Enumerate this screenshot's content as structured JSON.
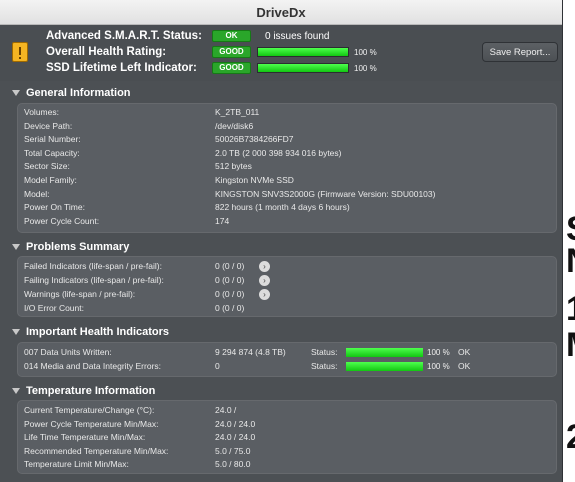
{
  "window": {
    "title": "DriveDx"
  },
  "header": {
    "smart_label": "Advanced S.M.A.R.T. Status:",
    "smart_badge": "OK",
    "smart_issues": "0 issues found",
    "health_label": "Overall Health Rating:",
    "health_badge": "GOOD",
    "health_percent": 100,
    "health_pct_text": "100 %",
    "ssd_label": "SSD Lifetime Left Indicator:",
    "ssd_badge": "GOOD",
    "ssd_percent": 100,
    "ssd_pct_text": "100 %",
    "save_button": "Save Report..."
  },
  "general": {
    "title": "General Information",
    "rows": [
      {
        "label": "Volumes:",
        "value": "K_2TB_011"
      },
      {
        "label": "Device Path:",
        "value": "/dev/disk6"
      },
      {
        "label": "Serial Number:",
        "value": "50026B7384266FD7"
      },
      {
        "label": "Total Capacity:",
        "value": "2.0 TB (2 000 398 934 016 bytes)"
      },
      {
        "label": "Sector Size:",
        "value": "512 bytes"
      },
      {
        "label": "Model Family:",
        "value": "Kingston NVMe SSD"
      },
      {
        "label": "Model:",
        "value": "KINGSTON SNV3S2000G  (Firmware Version: SDU00103)"
      },
      {
        "label": "Power On Time:",
        "value": "822 hours (1 month 4 days 6 hours)"
      },
      {
        "label": "Power Cycle Count:",
        "value": "174"
      }
    ]
  },
  "problems": {
    "title": "Problems Summary",
    "rows": [
      {
        "label": "Failed Indicators (life-span / pre-fail):",
        "value": "0 (0 / 0)"
      },
      {
        "label": "Failing Indicators (life-span / pre-fail):",
        "value": "0 (0 / 0)"
      },
      {
        "label": "Warnings (life-span / pre-fail):",
        "value": "0 (0 / 0)"
      },
      {
        "label": "I/O Error Count:",
        "value": "0 (0 / 0)"
      }
    ]
  },
  "health_indicators": {
    "title": "Important Health Indicators",
    "status_label": "Status:",
    "rows": [
      {
        "label": "007  Data Units Written:",
        "value": "9 294 874 (4.8 TB)",
        "percent": 100,
        "pct_text": "100 %",
        "status": "OK"
      },
      {
        "label": "014  Media and Data Integrity Errors:",
        "value": "0",
        "percent": 100,
        "pct_text": "100 %",
        "status": "OK"
      }
    ]
  },
  "temperature": {
    "title": "Temperature Information",
    "rows": [
      {
        "label": "Current Temperature/Change (°C):",
        "value": "24.0 /"
      },
      {
        "label": "Power Cycle Temperature Min/Max:",
        "value": "24.0 / 24.0"
      },
      {
        "label": "Life Time Temperature Min/Max:",
        "value": "24.0 / 24.0"
      },
      {
        "label": "Recommended Temperature Min/Max:",
        "value": "5.0   / 75.0"
      },
      {
        "label": "Temperature Limit Min/Max:",
        "value": "5.0   / 80.0"
      }
    ]
  },
  "background_text": [
    "S",
    "N",
    "1",
    "M",
    "2"
  ],
  "colors": {
    "ok_green": "#2aa62a",
    "bar_green": "#22dd22",
    "window_bg": "#4c5054",
    "panel_bg": "#5a5e63"
  }
}
